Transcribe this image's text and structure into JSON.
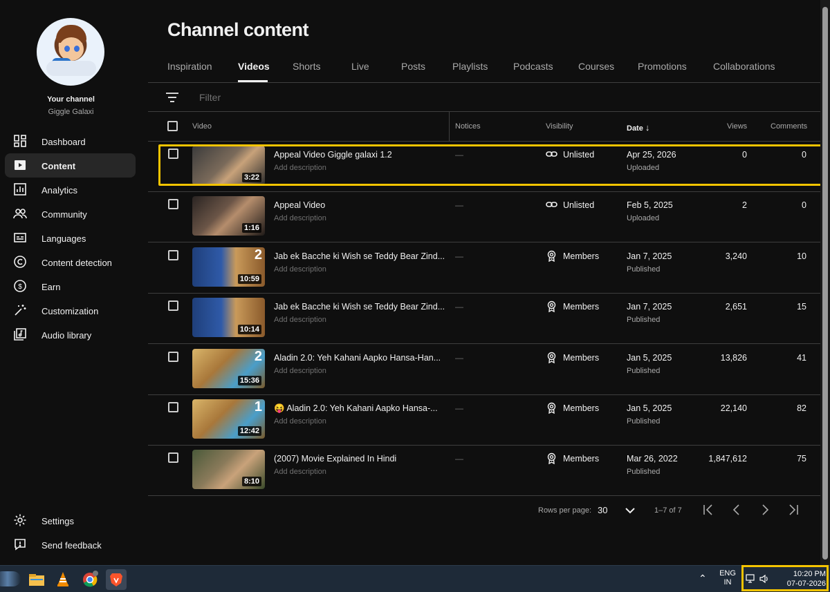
{
  "sidebar": {
    "channel_title": "Your channel",
    "channel_name": "Giggle Galaxi",
    "items": [
      {
        "label": "Dashboard",
        "icon": "dashboard-icon"
      },
      {
        "label": "Content",
        "icon": "content-icon"
      },
      {
        "label": "Analytics",
        "icon": "analytics-icon"
      },
      {
        "label": "Community",
        "icon": "community-icon"
      },
      {
        "label": "Languages",
        "icon": "languages-icon"
      },
      {
        "label": "Content detection",
        "icon": "copyright-icon"
      },
      {
        "label": "Earn",
        "icon": "dollar-icon"
      },
      {
        "label": "Customization",
        "icon": "magic-wand-icon"
      },
      {
        "label": "Audio library",
        "icon": "audio-library-icon"
      }
    ],
    "settings": "Settings",
    "feedback": "Send feedback"
  },
  "main": {
    "title": "Channel content",
    "tabs": [
      "Inspiration",
      "Videos",
      "Shorts",
      "Live",
      "Posts",
      "Playlists",
      "Podcasts",
      "Courses",
      "Promotions",
      "Collaborations"
    ],
    "active_tab": "Videos",
    "filter_placeholder": "Filter",
    "columns": {
      "video": "Video",
      "notices": "Notices",
      "visibility": "Visibility",
      "date": "Date",
      "views": "Views",
      "comments": "Comments"
    },
    "rows": [
      {
        "title": "Appeal Video Giggle galaxi 1.2",
        "desc": "Add description",
        "duration": "3:22",
        "notice": "—",
        "visibility": "Unlisted",
        "date": "Apr 25, 2026",
        "status": "Uploaded",
        "views": "0",
        "comments": "0"
      },
      {
        "title": "Appeal Video",
        "desc": "Add description",
        "duration": "1:16",
        "notice": "—",
        "visibility": "Unlisted",
        "date": "Feb 5, 2025",
        "status": "Uploaded",
        "views": "2",
        "comments": "0"
      },
      {
        "title": "Jab ek Bacche ki Wish se Teddy Bear Zind...",
        "desc": "Add description",
        "duration": "10:59",
        "badge": "2",
        "notice": "—",
        "visibility": "Members",
        "date": "Jan 7, 2025",
        "status": "Published",
        "views": "3,240",
        "comments": "10"
      },
      {
        "title": "Jab ek Bacche ki Wish se Teddy Bear Zind...",
        "desc": "Add description",
        "duration": "10:14",
        "notice": "—",
        "visibility": "Members",
        "date": "Jan 7, 2025",
        "status": "Published",
        "views": "2,651",
        "comments": "15"
      },
      {
        "title": "Aladin 2.0: Yeh Kahani Aapko Hansa-Han...",
        "desc": "Add description",
        "duration": "15:36",
        "badge": "2",
        "notice": "—",
        "visibility": "Members",
        "date": "Jan 5, 2025",
        "status": "Published",
        "views": "13,826",
        "comments": "41"
      },
      {
        "title": "😝 Aladin 2.0: Yeh Kahani Aapko Hansa-...",
        "desc": "Add description",
        "duration": "12:42",
        "badge": "1",
        "notice": "—",
        "visibility": "Members",
        "date": "Jan 5, 2025",
        "status": "Published",
        "views": "22,140",
        "comments": "82"
      },
      {
        "title": "(2007) Movie Explained In Hindi",
        "desc": "Add description",
        "duration": "8:10",
        "notice": "—",
        "visibility": "Members",
        "date": "Mar 26, 2022",
        "status": "Published",
        "views": "1,847,612",
        "comments": "75"
      }
    ],
    "pager": {
      "rows_per_page_label": "Rows per page:",
      "rows_per_page": "30",
      "range": "1–7 of 7"
    }
  },
  "taskbar": {
    "lang_top": "ENG",
    "lang_bottom": "IN",
    "time": "10:20 PM",
    "date": "07-07-2026"
  },
  "colors": {
    "accent_highlight": "#f5c400",
    "background": "#0f0f0f"
  }
}
